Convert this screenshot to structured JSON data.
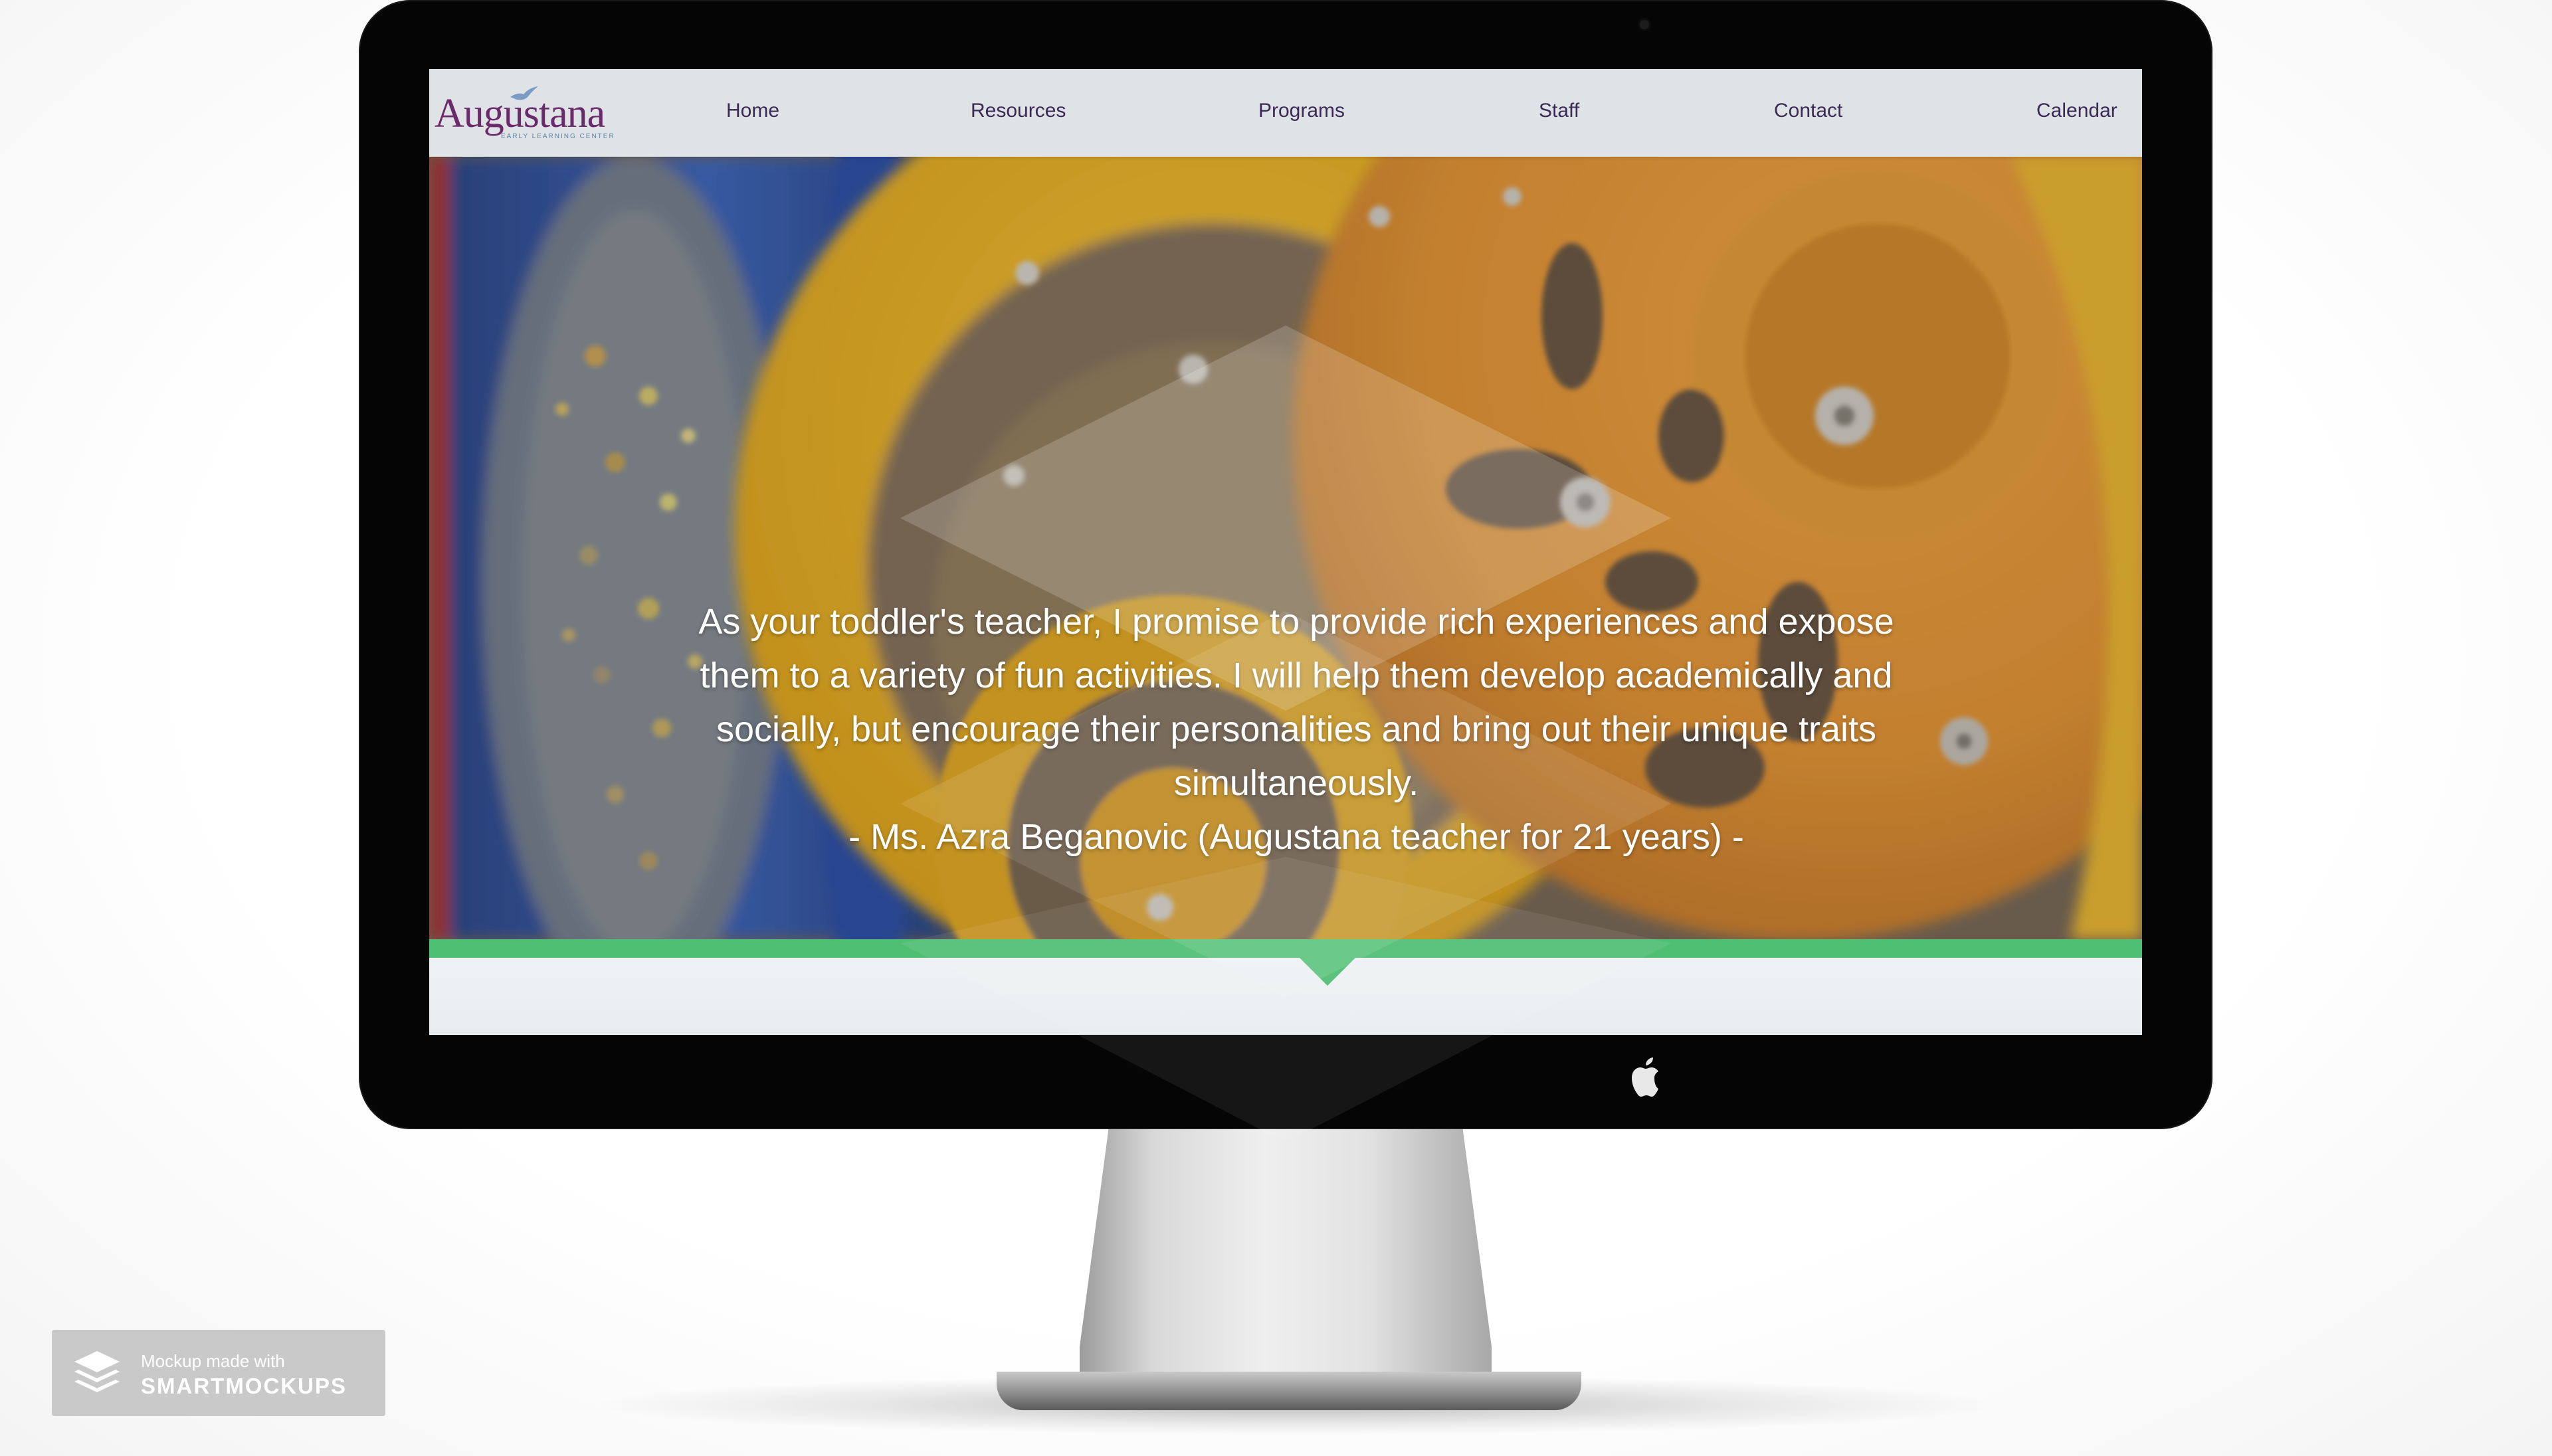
{
  "site": {
    "logo_text": "Augustana",
    "logo_subtitle": "EARLY LEARNING CENTER"
  },
  "nav": {
    "items": [
      {
        "label": "Home"
      },
      {
        "label": "Resources"
      },
      {
        "label": "Programs"
      },
      {
        "label": "Staff"
      },
      {
        "label": "Contact"
      },
      {
        "label": "Calendar"
      }
    ]
  },
  "hero": {
    "quote_lines": [
      "As your toddler's teacher, I promise to provide rich experiences and expose",
      "them to a variety of fun activities. I will help them develop academically and",
      "socially, but encourage their personalities and bring out their unique traits",
      "simultaneously."
    ],
    "attribution": "- Ms. Azra Beganovic (Augustana teacher for 21 years) -"
  },
  "badge": {
    "line1": "Mockup made with",
    "line2": "SMARTMOCKUPS"
  },
  "icons": {
    "logo_bird": "bird-icon",
    "apple": "apple-logo-icon",
    "camera": "camera-icon",
    "badge": "layers-icon"
  },
  "colors": {
    "brand_purple": "#6b2a6b",
    "accent_green": "#4fbf74",
    "nav_bg": "#dfe3e6",
    "nav_text": "#3b2a55"
  }
}
